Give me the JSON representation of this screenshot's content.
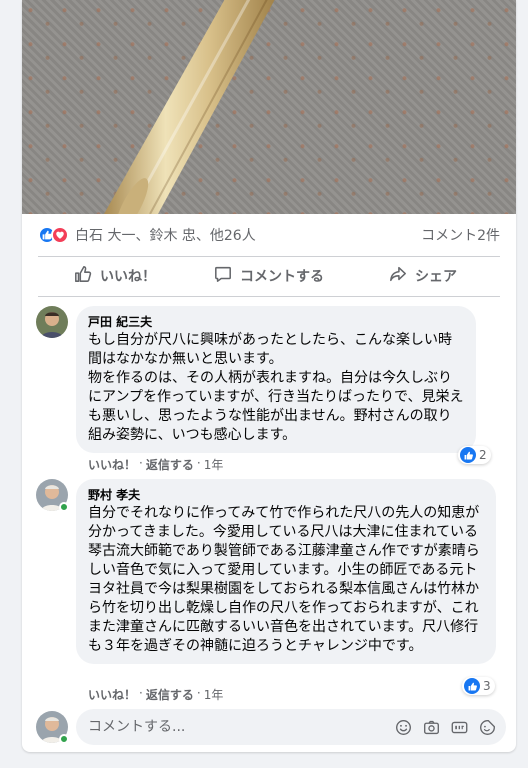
{
  "post": {
    "reactors": "白石 大一、鈴木 忠、他26人",
    "comment_count": "コメント2件",
    "actions": {
      "like": "いいね！",
      "comment": "コメントする",
      "share": "シェア"
    }
  },
  "comments": [
    {
      "author": "戸田 紀三夫",
      "text": "もし自分が尺八に興味があったとしたら、こんな楽しい時間はなかなか無いと思います。\n物を作るのは、その人柄が表れますね。自分は今久しぶりにアンプを作っていますが、行き当たりばったりで、見栄えも悪いし、思ったような性能が出ません。野村さんの取り組み姿勢に、いつも感心します。",
      "like_label": "いいね！",
      "reply_label": "返信する",
      "time": "1年",
      "reactions": "2"
    },
    {
      "author": "野村 孝夫",
      "text": "自分でそれなりに作ってみて竹で作られた尺八の先人の知恵が分かってきました。今愛用している尺八は大津に住まれている琴古流大師範であり製管師である江藤津童さん作ですが素晴らしい音色で気に入って愛用しています。小生の師匠である元トヨタ社員で今は梨果樹園をしておられる梨本信風さんは竹林から竹を切り出し乾燥し自作の尺八を作っておられますが、これまた津童さんに匹敵するいい音色を出されています。尺八修行も３年を過ぎその神髄に迫ろうとチャレンジ中です。",
      "like_label": "いいね！",
      "reply_label": "返信する",
      "time": "1年",
      "reactions": "3"
    }
  ],
  "composer": {
    "placeholder": "コメントする..."
  },
  "icons": {
    "like_reaction": "like-icon",
    "love_reaction": "love-icon",
    "like_action": "thumbs-up-icon",
    "comment_action": "speech-bubble-icon",
    "share_action": "share-arrow-icon",
    "tools": [
      "emoji-icon",
      "camera-icon",
      "gif-icon",
      "sticker-icon"
    ]
  },
  "colors": {
    "brand_blue": "#1877f2",
    "love_red": "#f33e58",
    "secondary_text": "#65676b",
    "bubble_bg": "#f0f2f5",
    "online_green": "#31a24c"
  }
}
